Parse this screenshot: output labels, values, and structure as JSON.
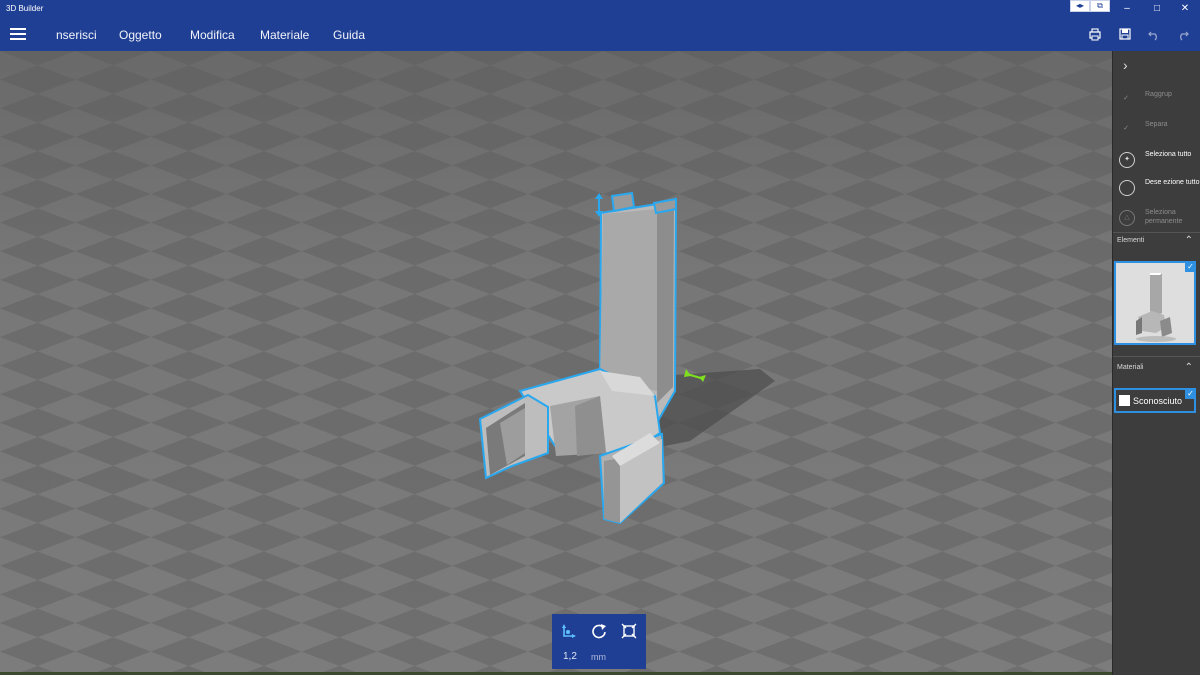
{
  "window": {
    "title": "3D Builder",
    "btn_a": "◂▸",
    "btn_b": "⧉",
    "minimize": "–",
    "maximize": "□",
    "close": "✕"
  },
  "menubar": {
    "items": [
      "nserisci",
      "Oggetto",
      "Modifica",
      "Materiale",
      "Guida"
    ],
    "right_icons": [
      "print-icon",
      "save-icon",
      "undo-icon",
      "redo-icon"
    ]
  },
  "panel": {
    "actions": [
      {
        "label": "Raggrup",
        "icon": "group-icon",
        "enabled": false
      },
      {
        "label": "Separa",
        "icon": "ungroup-icon",
        "enabled": false
      },
      {
        "label": "Seleziona tutto",
        "icon": "select-all-icon",
        "enabled": true
      },
      {
        "label": "Dese ezione tutto",
        "icon": "deselect-all-icon",
        "enabled": true
      },
      {
        "label": "Seleziona permanente",
        "icon": "select-permanent-icon",
        "enabled": false
      }
    ],
    "elements_header": "Elementi",
    "materials_header": "Materiali",
    "material_selected": "Sconosciuto",
    "accent_color": "#2f8fe0"
  },
  "bottombar": {
    "tools": [
      "move-icon",
      "rotate-icon",
      "scale-icon"
    ],
    "value": "1,2",
    "unit": "mm"
  }
}
